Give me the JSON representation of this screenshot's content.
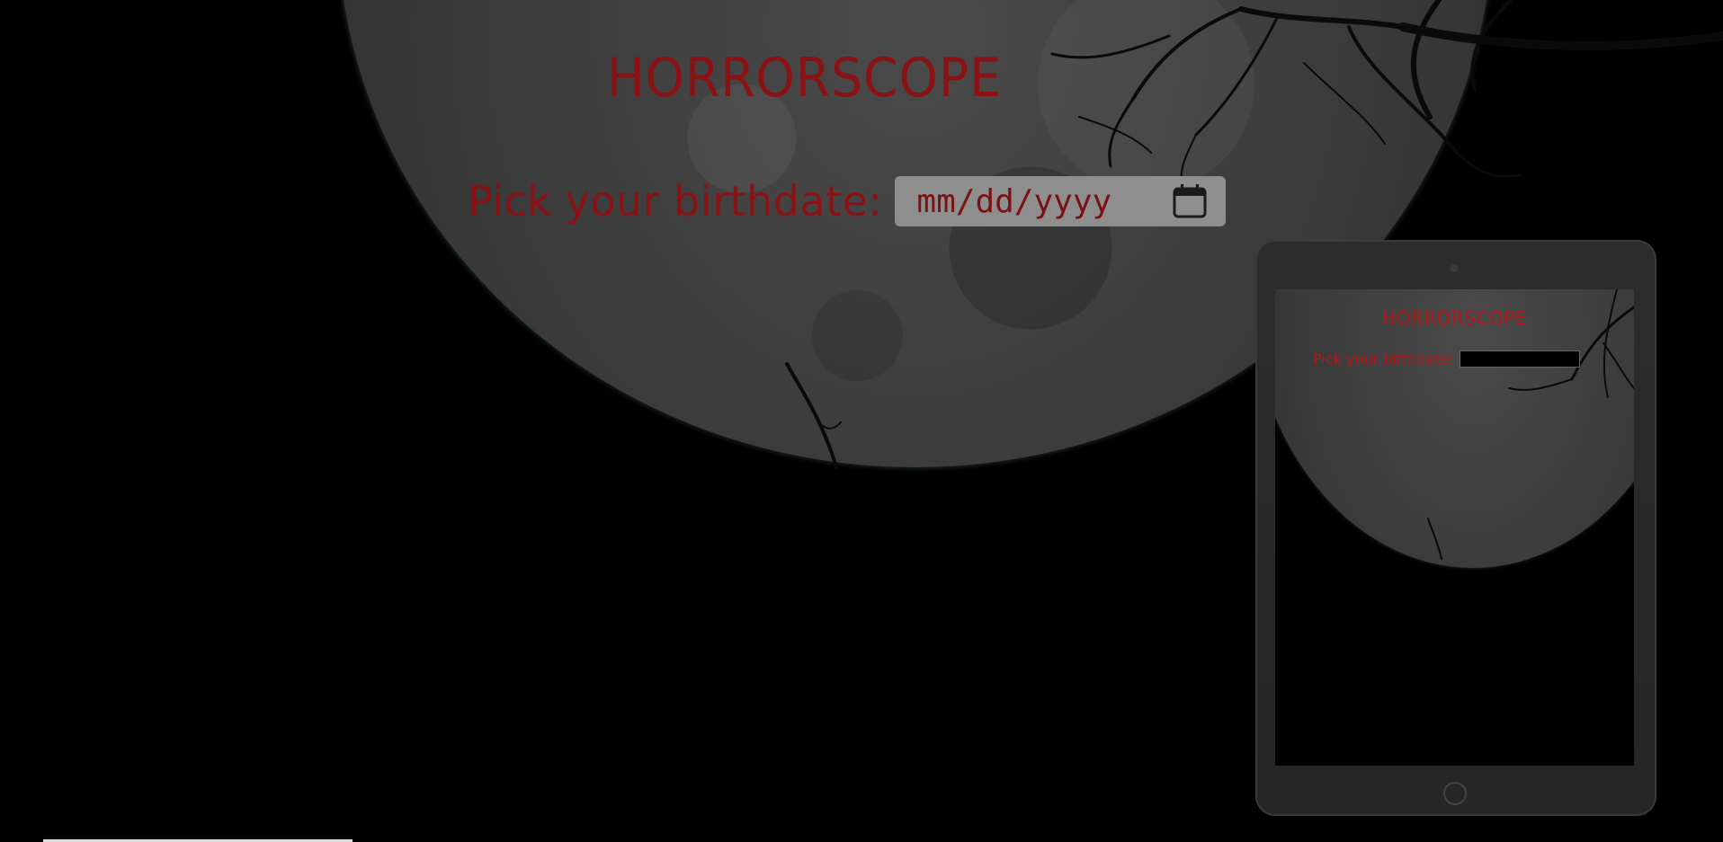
{
  "page": {
    "title": "HORRORSCOPE",
    "birthdate_label": "Pick your birthdate:",
    "date_input": {
      "placeholder": "mm/dd/yyyy"
    }
  },
  "tablet_preview": {
    "title": "HORRORSCOPE",
    "birthdate_label": "Pick your birthdate:"
  },
  "colors": {
    "title": "#8a1214",
    "background": "#000000",
    "input_background": "#8e8e8e"
  }
}
